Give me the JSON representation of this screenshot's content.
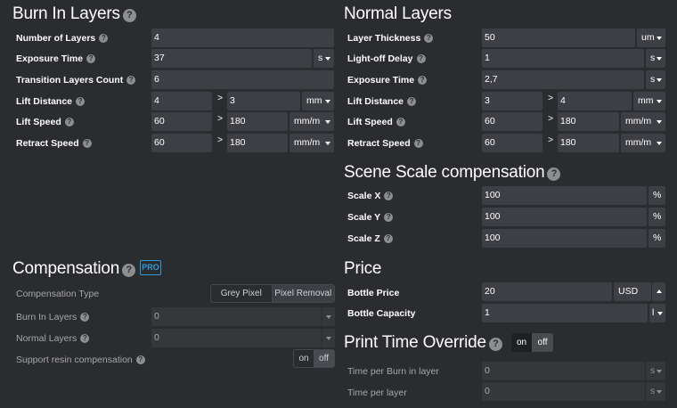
{
  "burn_in": {
    "title": "Burn In Layers",
    "number_of_layers": {
      "label": "Number of Layers",
      "value": "4"
    },
    "exposure_time": {
      "label": "Exposure Time",
      "value": "37",
      "unit": "s"
    },
    "transition_layers": {
      "label": "Transition Layers Count",
      "value": "6"
    },
    "lift_distance": {
      "label": "Lift Distance",
      "value1": "4",
      "value2": "3",
      "unit": "mm"
    },
    "lift_speed": {
      "label": "Lift Speed",
      "value1": "60",
      "value2": "180",
      "unit": "mm/m"
    },
    "retract_speed": {
      "label": "Retract Speed",
      "value1": "60",
      "value2": "180",
      "unit": "mm/m"
    }
  },
  "normal": {
    "title": "Normal Layers",
    "layer_thickness": {
      "label": "Layer Thickness",
      "value": "50",
      "unit": "um"
    },
    "light_off_delay": {
      "label": "Light-off Delay",
      "value": "1",
      "unit": "s"
    },
    "exposure_time": {
      "label": "Exposure Time",
      "value": "2,7",
      "unit": "s"
    },
    "lift_distance": {
      "label": "Lift Distance",
      "value1": "3",
      "value2": "4",
      "unit": "mm"
    },
    "lift_speed": {
      "label": "Lift Speed",
      "value1": "60",
      "value2": "180",
      "unit": "mm/m"
    },
    "retract_speed": {
      "label": "Retract Speed",
      "value1": "60",
      "value2": "180",
      "unit": "mm/m"
    }
  },
  "scale": {
    "title": "Scene Scale compensation",
    "x": {
      "label": "Scale X",
      "value": "100",
      "unit": "%"
    },
    "y": {
      "label": "Scale Y",
      "value": "100",
      "unit": "%"
    },
    "z": {
      "label": "Scale Z",
      "value": "100",
      "unit": "%"
    }
  },
  "compensation": {
    "title": "Compensation",
    "badge": "PRO",
    "type": {
      "label": "Compensation Type",
      "option1": "Grey Pixel",
      "option2": "Pixel Removal"
    },
    "burn_in_layers": {
      "label": "Burn In Layers",
      "value": "0"
    },
    "normal_layers": {
      "label": "Normal Layers",
      "value": "0"
    },
    "support_resin": {
      "label": "Support resin compensation",
      "on": "on",
      "off": "off"
    }
  },
  "price": {
    "title": "Price",
    "bottle_price": {
      "label": "Bottle Price",
      "value": "20",
      "unit": "USD"
    },
    "bottle_capacity": {
      "label": "Bottle Capacity",
      "value": "1",
      "unit": "l"
    }
  },
  "print_time": {
    "title": "Print Time Override",
    "on": "on",
    "off": "off",
    "burn_in": {
      "label": "Time per Burn in layer",
      "value": "0",
      "unit": "s"
    },
    "per_layer": {
      "label": "Time per layer",
      "value": "0",
      "unit": "s"
    }
  },
  "help_glyph": "?",
  "gt_glyph": ">"
}
